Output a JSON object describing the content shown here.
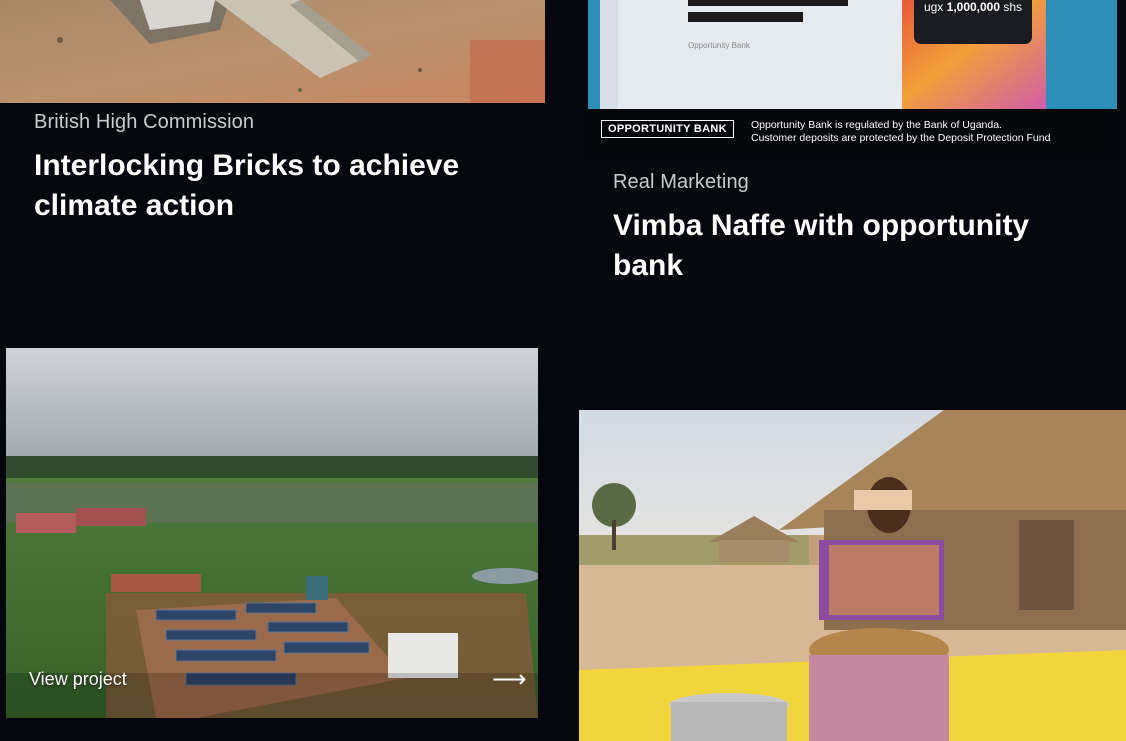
{
  "projects": [
    {
      "client": "British High Commission",
      "title": "Interlocking Bricks to achieve climate action"
    },
    {
      "client": "Real Marketing",
      "title": "Vimba Naffe with opportunity bank",
      "image_text": {
        "logo": "OPPORTUNITY BANK",
        "note_line1": "Opportunity Bank is regulated by the Bank of Uganda.",
        "note_line2": "Customer deposits are protected by the Deposit Protection Fund",
        "amount_prefix": "ugx",
        "amount": "1,000,000",
        "amount_suffix": "shs",
        "card_caption": "Opportunity Bank"
      }
    },
    {
      "cta": "View project",
      "arrow": "⟶"
    },
    {}
  ],
  "colors": {
    "background": "#06070e",
    "client_text": "#c9cbd2",
    "title_text": "#ffffff"
  }
}
